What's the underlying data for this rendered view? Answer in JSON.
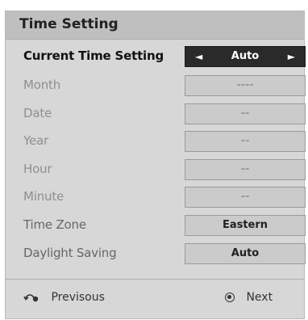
{
  "title": "Time Setting",
  "rows": [
    {
      "label": "Current Time Setting",
      "value": "Auto",
      "arrow_left": "◄",
      "arrow_right": "►"
    },
    {
      "label": "Month",
      "value": "----"
    },
    {
      "label": "Date",
      "value": "--"
    },
    {
      "label": "Year",
      "value": "--"
    },
    {
      "label": "Hour",
      "value": "--"
    },
    {
      "label": "Minute",
      "value": "--"
    },
    {
      "label": "Time Zone",
      "value": "Eastern"
    },
    {
      "label": "Daylight Saving",
      "value": "Auto"
    }
  ],
  "footer": {
    "previous_label": "Previsous",
    "next_label": "Next",
    "previous_icon": "back-arrow-icon",
    "next_icon": "ok-button-icon"
  }
}
